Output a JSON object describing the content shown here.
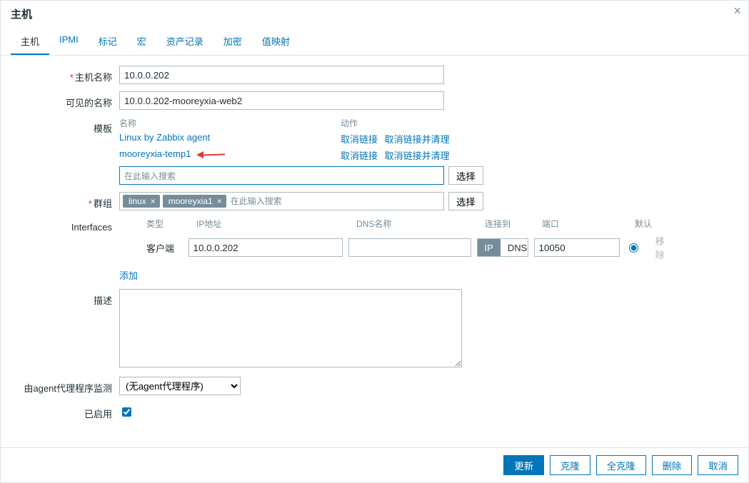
{
  "dialog_title": "主机",
  "close_icon": "×",
  "tabs": {
    "host": "主机",
    "ipmi": "IPMI",
    "tags": "标记",
    "macros": "宏",
    "inventory": "资产记录",
    "encryption": "加密",
    "valuemap": "值映射"
  },
  "labels": {
    "host_name": "主机名称",
    "visible_name": "可见的名称",
    "templates": "模板",
    "groups": "群组",
    "interfaces": "Interfaces",
    "description": "描述",
    "monitored_by": "由agent代理程序监测",
    "enabled": "已启用"
  },
  "fields": {
    "host_name": "10.0.0.202",
    "visible_name": "10.0.0.202-mooreyxia-web2",
    "description": "",
    "proxy_selected": "(无agent代理程序)"
  },
  "templates_panel": {
    "header_name": "名称",
    "header_action": "动作",
    "items": [
      {
        "name": "Linux by Zabbix agent",
        "unlink": "取消链接",
        "unlink_clear": "取消链接并清理"
      },
      {
        "name": "mooreyxia-temp1",
        "unlink": "取消链接",
        "unlink_clear": "取消链接并清理"
      }
    ],
    "search_placeholder": "在此输入搜索",
    "select_btn": "选择"
  },
  "groups_panel": {
    "tags": [
      "linux",
      "mooreyxia1"
    ],
    "search_placeholder": "在此输入搜索",
    "select_btn": "选择"
  },
  "interfaces_panel": {
    "headers": {
      "type": "类型",
      "ip": "IP地址",
      "dns": "DNS名称",
      "connect": "连接到",
      "port": "端口",
      "default": "默认"
    },
    "row": {
      "type": "客户端",
      "ip": "10.0.0.202",
      "dns": "",
      "connect_ip": "IP",
      "connect_dns": "DNS",
      "port": "10050",
      "remove": "移除"
    },
    "add": "添加"
  },
  "footer": {
    "update": "更新",
    "clone": "克隆",
    "full_clone": "全克隆",
    "delete": "删除",
    "cancel": "取消"
  }
}
